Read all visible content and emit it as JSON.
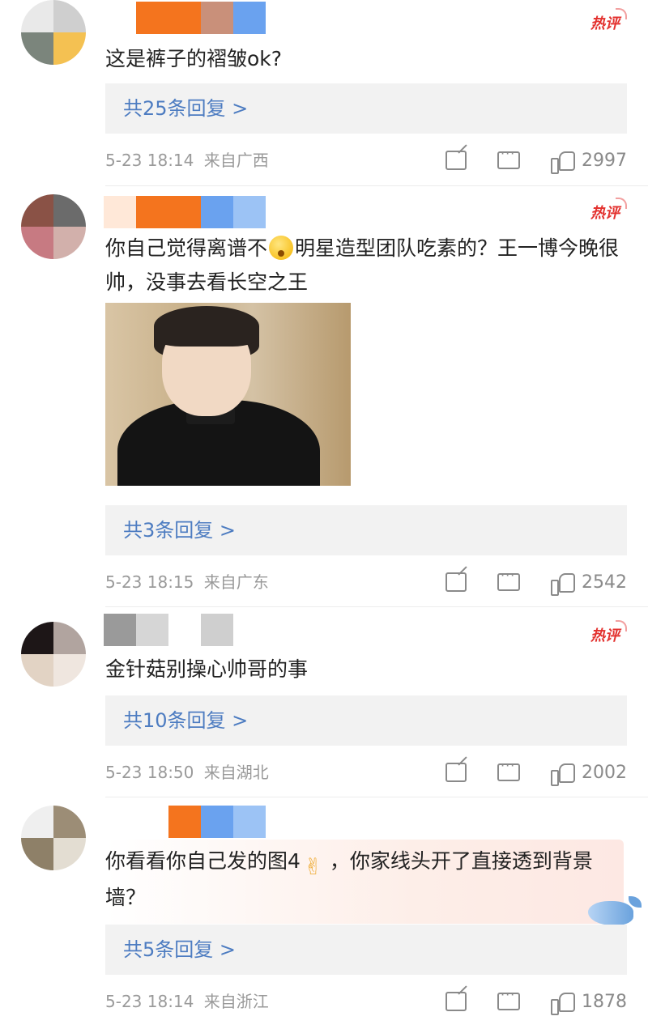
{
  "comments": [
    {
      "hot_badge": "热评",
      "text": "这是裤子的褶皱ok?",
      "reply_label": "共25条回复 >",
      "time": "5-23 18:14",
      "location": "来自广西",
      "likes": "2997",
      "avatar_colors": [
        "#e9e9e9",
        "#cfcfcf",
        "#9a9a9a",
        "#7b857c",
        "#f4c152",
        "#ffffff"
      ],
      "name_colors": [
        "#ffffff",
        "#f4741e",
        "#f4741e",
        "#c9907a",
        "#6aa2ef"
      ]
    },
    {
      "hot_badge": "热评",
      "text_before_emoji": "你自己觉得离谱不",
      "text_after_emoji": "明星造型团队吃素的？王一博今晚很帅，没事去看长空之王",
      "reply_label": "共3条回复 >",
      "time": "5-23 18:15",
      "location": "来自广东",
      "likes": "2542",
      "avatar_colors": [
        "#f1f1f1",
        "#8a5246",
        "#6b6b6b",
        "#c77a82",
        "#d2b0ab",
        "#ffffff"
      ],
      "name_colors": [
        "#ffe8d8",
        "#f4741e",
        "#f4741e",
        "#6aa2ef",
        "#9cc3f5"
      ]
    },
    {
      "hot_badge": "热评",
      "text": "金针菇别操心帅哥的事",
      "reply_label": "共10条回复 >",
      "time": "5-23 18:50",
      "location": "来自湖北",
      "likes": "2002",
      "avatar_colors": [
        "#1d1617",
        "#b1a49f",
        "#e2d3c4",
        "#c9b2a6",
        "#efe6df",
        "#ffffff"
      ],
      "name_colors": [
        "#9a9a9a",
        "#d6d6d6",
        "#ffffff",
        "#cfcfcf",
        "#ffffff"
      ]
    },
    {
      "text_before_emoji": "你看看你自己发的图4",
      "text_after_emoji": "，你家线头开了直接透到背景墙？",
      "reply_label": "共5条回复 >",
      "time": "5-23 18:14",
      "location": "来自浙江",
      "likes": "1878",
      "avatar_colors": [
        "#efefef",
        "#9c8d76",
        "#8e8068",
        "#e3ddd2",
        "#bfb4a2",
        "#ffffff"
      ],
      "name_colors": [
        "#ffffff",
        "#f4741e",
        "#6aa2ef",
        "#9cc3f5",
        "#ffffff"
      ]
    }
  ],
  "icons": {
    "share": "share-icon",
    "comment": "comment-icon",
    "like": "like-icon",
    "emoji_flushed": "flushed-face-emoji-icon",
    "emoji_victory": "victory-hand-emoji-icon",
    "whale": "whale-decoration-icon"
  }
}
